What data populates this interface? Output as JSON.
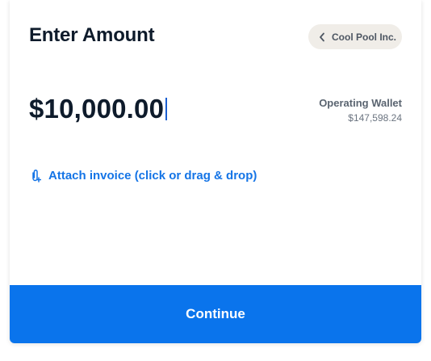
{
  "header": {
    "title": "Enter Amount",
    "payee": {
      "label": "Cool Pool Inc.",
      "icon": "chevron-left-icon"
    }
  },
  "amount": {
    "value": "$10,000.00"
  },
  "wallet": {
    "name": "Operating Wallet",
    "balance": "$147,598.24"
  },
  "attach": {
    "label": "Attach invoice (click or drag & drop)",
    "icon": "paperclip-add-icon"
  },
  "footer": {
    "continue_label": "Continue"
  },
  "colors": {
    "primary": "#0a74ec",
    "link": "#1474e6",
    "heading": "#0e1b2b",
    "pill_bg": "#f0ede8"
  }
}
